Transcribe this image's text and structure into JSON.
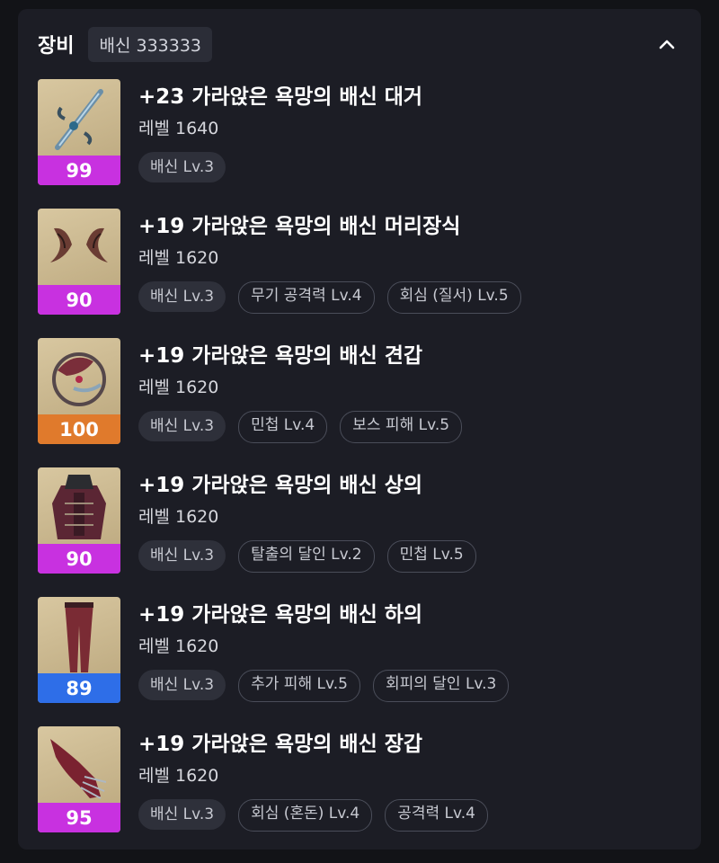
{
  "header": {
    "title": "장비",
    "set_badge": "배신 333333"
  },
  "colors": {
    "quality_magenta": "#c831e0",
    "quality_orange": "#e07a2c",
    "quality_blue": "#2e6ee8",
    "panel_bg": "#1c1d25",
    "page_bg": "#121317"
  },
  "items": [
    {
      "name": "+23 가라앉은 욕망의 배신 대거",
      "level": "레벨 1640",
      "quality": "99",
      "quality_color": "#c831e0",
      "icon": "dagger-icon",
      "tags": [
        {
          "label": "배신 Lv.3",
          "style": "filled"
        }
      ]
    },
    {
      "name": "+19 가라앉은 욕망의 배신 머리장식",
      "level": "레벨 1620",
      "quality": "90",
      "quality_color": "#c831e0",
      "icon": "headgear-icon",
      "tags": [
        {
          "label": "배신 Lv.3",
          "style": "filled"
        },
        {
          "label": "무기 공격력 Lv.4",
          "style": "outline"
        },
        {
          "label": "회심 (질서) Lv.5",
          "style": "outline"
        }
      ]
    },
    {
      "name": "+19 가라앉은 욕망의 배신 견갑",
      "level": "레벨 1620",
      "quality": "100",
      "quality_color": "#e07a2c",
      "icon": "shoulder-icon",
      "tags": [
        {
          "label": "배신 Lv.3",
          "style": "filled"
        },
        {
          "label": "민첩 Lv.4",
          "style": "outline"
        },
        {
          "label": "보스 피해 Lv.5",
          "style": "outline"
        }
      ]
    },
    {
      "name": "+19 가라앉은 욕망의 배신 상의",
      "level": "레벨 1620",
      "quality": "90",
      "quality_color": "#c831e0",
      "icon": "chest-armor-icon",
      "tags": [
        {
          "label": "배신 Lv.3",
          "style": "filled"
        },
        {
          "label": "탈출의 달인 Lv.2",
          "style": "outline"
        },
        {
          "label": "민첩 Lv.5",
          "style": "outline"
        }
      ]
    },
    {
      "name": "+19 가라앉은 욕망의 배신 하의",
      "level": "레벨 1620",
      "quality": "89",
      "quality_color": "#2e6ee8",
      "icon": "pants-icon",
      "tags": [
        {
          "label": "배신 Lv.3",
          "style": "filled"
        },
        {
          "label": "추가 피해 Lv.5",
          "style": "outline"
        },
        {
          "label": "회피의 달인 Lv.3",
          "style": "outline"
        }
      ]
    },
    {
      "name": "+19 가라앉은 욕망의 배신 장갑",
      "level": "레벨 1620",
      "quality": "95",
      "quality_color": "#c831e0",
      "icon": "gloves-icon",
      "tags": [
        {
          "label": "배신 Lv.3",
          "style": "filled"
        },
        {
          "label": "회심 (혼돈) Lv.4",
          "style": "outline"
        },
        {
          "label": "공격력 Lv.4",
          "style": "outline"
        }
      ]
    }
  ]
}
